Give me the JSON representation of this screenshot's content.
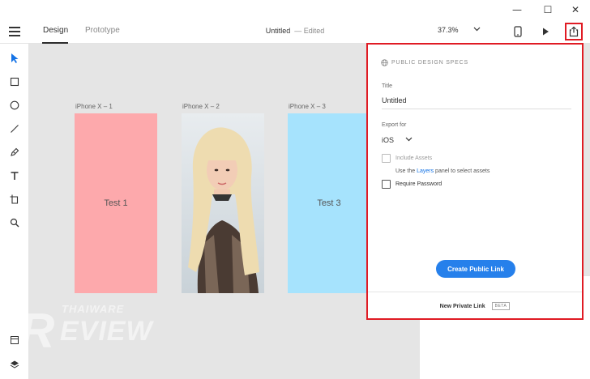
{
  "window": {
    "minimize_glyph": "—",
    "maximize_glyph": "☐",
    "close_glyph": "✕"
  },
  "toolbar": {
    "tabs": [
      {
        "label": "Design",
        "active": true
      },
      {
        "label": "Prototype",
        "active": false
      }
    ],
    "document_title": "Untitled",
    "document_status": "— Edited",
    "zoom": "37.3%",
    "icons": [
      "hamburger-icon",
      "device-phone-icon",
      "play-icon",
      "share-icon"
    ]
  },
  "tools": [
    "select-icon",
    "rectangle-icon",
    "ellipse-icon",
    "line-icon",
    "pen-icon",
    "text-icon",
    "artboard-icon",
    "zoom-icon"
  ],
  "bottom_tools": [
    "assets-icon",
    "layers-icon"
  ],
  "artboards": [
    {
      "label": "iPhone X – 1",
      "content": "Test 1",
      "color": "#fda9ac"
    },
    {
      "label": "iPhone X – 2",
      "content": "",
      "color": "#d9cfc6"
    },
    {
      "label": "iPhone X – 3",
      "content": "Test 3",
      "color": "#a6e3fd"
    }
  ],
  "share_panel": {
    "heading": "PUBLIC DESIGN SPECS",
    "title_label": "Title",
    "title_value": "Untitled",
    "export_label": "Export for",
    "export_value": "iOS",
    "include_assets_label": "Include Assets",
    "hint_prefix": "Use the",
    "hint_link": "Layers",
    "hint_suffix": "panel to select assets",
    "require_password_label": "Require Password",
    "create_button": "Create Public Link",
    "private_link_label": "New Private Link",
    "beta_badge": "BETA"
  },
  "watermark": {
    "top": "THAIWARE",
    "main": "EVIEW",
    "letter": "R"
  },
  "colors": {
    "accent": "#2680eb",
    "highlight": "#e01b24",
    "tool_active": "#1473e6",
    "canvas": "#e5e5e5"
  }
}
